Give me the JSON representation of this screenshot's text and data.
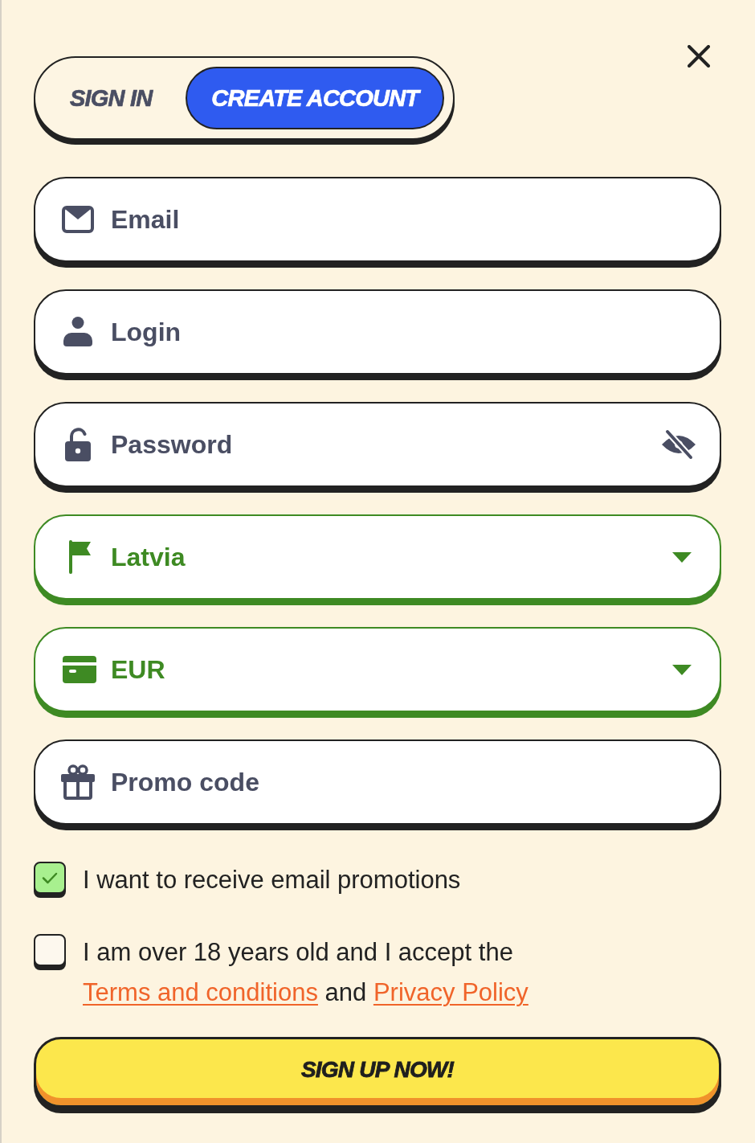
{
  "tabs": [
    {
      "label": "SIGN IN",
      "selected": false
    },
    {
      "label": "CREATE ACCOUNT",
      "selected": true
    }
  ],
  "fields": [
    {
      "kind": "email",
      "placeholder": "Email",
      "valid": false
    },
    {
      "kind": "login",
      "placeholder": "Login",
      "valid": false
    },
    {
      "kind": "password",
      "placeholder": "Password",
      "valid": false
    },
    {
      "kind": "country",
      "value": "Latvia",
      "valid": true
    },
    {
      "kind": "currency",
      "value": "EUR",
      "valid": true
    },
    {
      "kind": "promo",
      "placeholder": "Promo code",
      "valid": false
    }
  ],
  "consents": [
    {
      "checked": true,
      "parts": [
        {
          "kind": "text",
          "text": "I want to receive email promotions"
        }
      ]
    },
    {
      "checked": false,
      "parts": [
        {
          "kind": "text",
          "text": "I am over 18 years old and I accept the "
        },
        {
          "kind": "link",
          "text": "Terms and conditions"
        },
        {
          "kind": "text",
          "text": " and "
        },
        {
          "kind": "link",
          "text": "Privacy Policy"
        }
      ]
    }
  ],
  "submit_button": {
    "label": "SIGN UP NOW!"
  }
}
